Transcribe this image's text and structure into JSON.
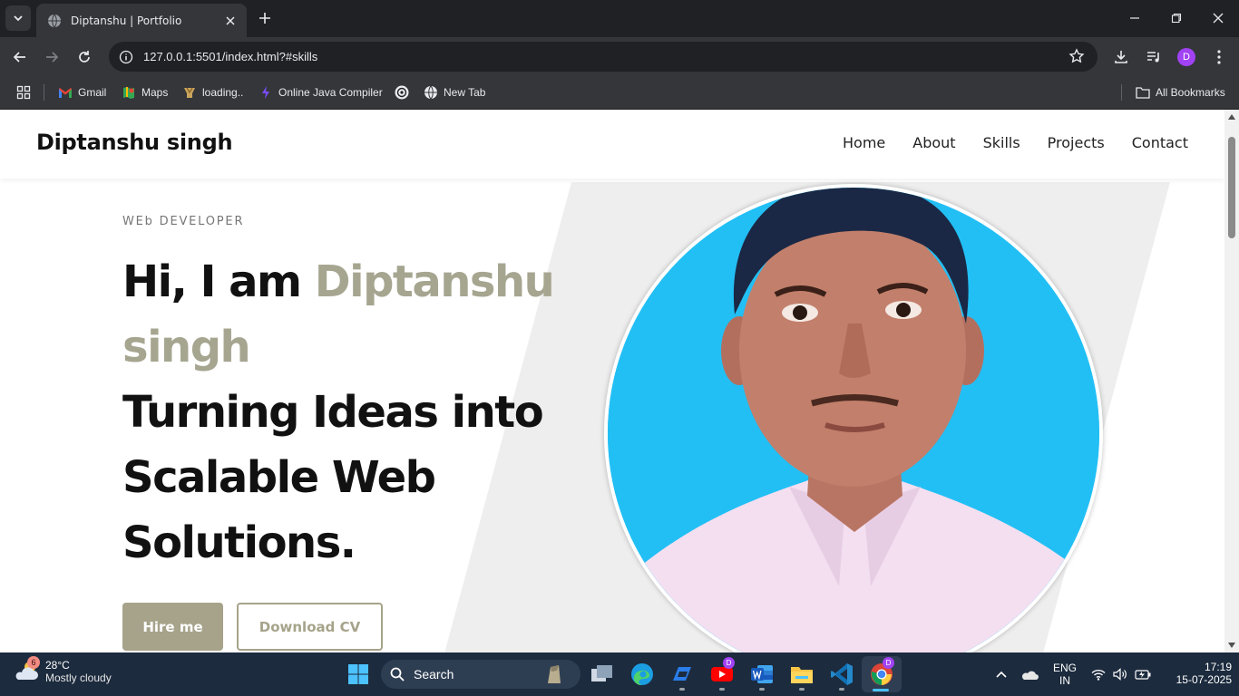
{
  "browser": {
    "tab_title": "Diptanshu | Portfolio",
    "url": "127.0.0.1:5501/index.html?#skills",
    "profile_initial": "D",
    "bookmarks": [
      {
        "label": "Gmail",
        "icon": "gmail-icon"
      },
      {
        "label": "Maps",
        "icon": "maps-icon"
      },
      {
        "label": "loading..",
        "icon": "bookmark-favicon-icon"
      },
      {
        "label": "Online Java Compiler",
        "icon": "compiler-icon"
      },
      {
        "label": "",
        "icon": "openai-icon"
      },
      {
        "label": "New Tab",
        "icon": "globe-icon"
      }
    ],
    "all_bookmarks": "All Bookmarks"
  },
  "site": {
    "logo": "Diptanshu singh",
    "nav": [
      "Home",
      "About",
      "Skills",
      "Projects",
      "Contact"
    ],
    "subtitle": "WEb DEVELOPER",
    "headline_prefix": "Hi, I am ",
    "headline_name": "Diptanshu singh",
    "headline_rest": "Turning Ideas into Scalable Web Solutions.",
    "buttons": {
      "hire": "Hire me",
      "cv": "Download CV"
    },
    "colors": {
      "accent": "#a6a38a",
      "photo_bg": "#22bff5",
      "hero_shape": "#eeeeee"
    }
  },
  "taskbar": {
    "weather_temp": "28°C",
    "weather_desc": "Mostly cloudy",
    "weather_badge": "6",
    "search_label": "Search",
    "language": "ENG",
    "region": "IN",
    "time": "17:19",
    "date": "15-07-2025",
    "app_badge": "D"
  }
}
